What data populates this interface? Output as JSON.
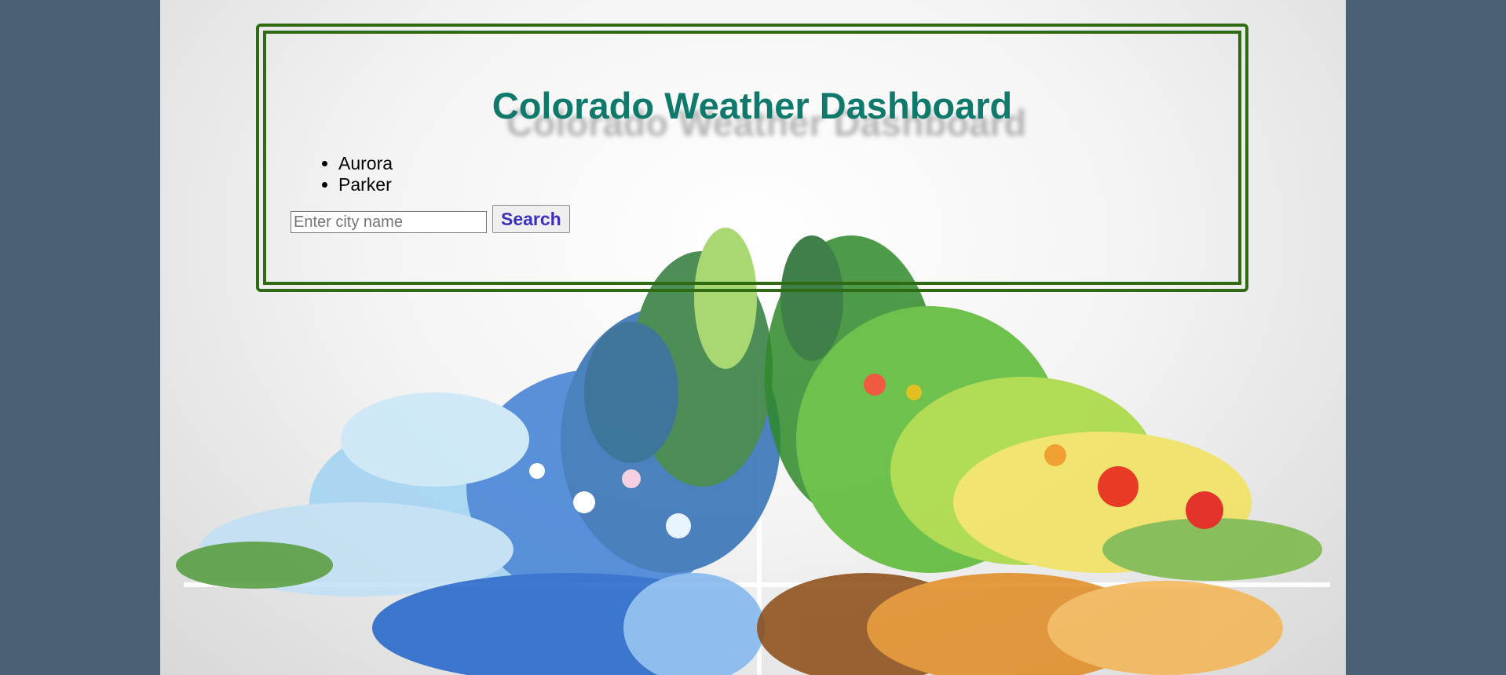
{
  "header": {
    "title": "Colorado Weather Dashboard"
  },
  "search_history": {
    "cities": [
      "Aurora",
      "Parker"
    ]
  },
  "search": {
    "placeholder": "Enter city name",
    "value": "",
    "button_label": "Search"
  },
  "colors": {
    "outer_background": "#4b6075",
    "panel_border": "#2f6b12",
    "title": "#0f7a6c",
    "button_text": "#3b2fbf"
  },
  "background_art": {
    "icon": "floral-seasons-illustration"
  }
}
